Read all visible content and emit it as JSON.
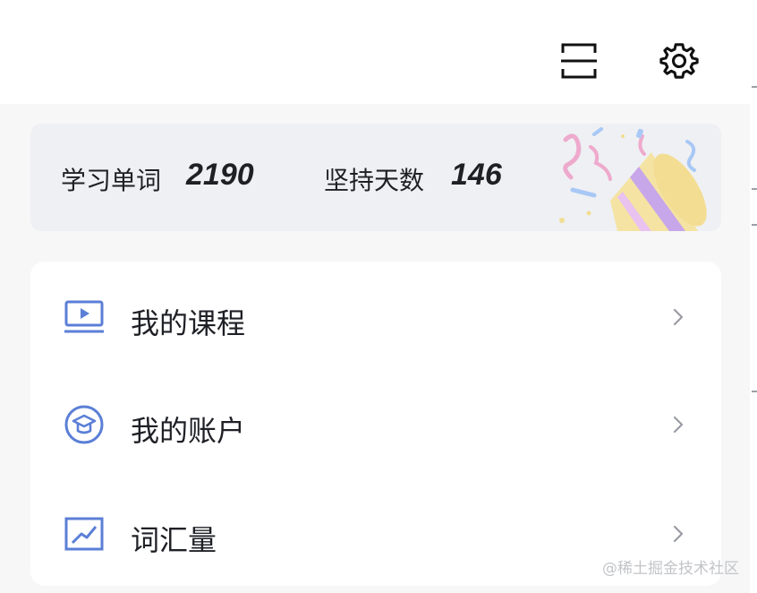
{
  "header": {
    "icons": [
      "scan-icon",
      "settings-gear-icon"
    ]
  },
  "stats": {
    "words_label": "学习单词",
    "words_value": "2190",
    "days_label": "坚持天数",
    "days_value": "146"
  },
  "menu": {
    "items": [
      {
        "label": "我的课程",
        "icon": "video-course-icon"
      },
      {
        "label": "我的账户",
        "icon": "graduation-cap-icon"
      },
      {
        "label": "词汇量",
        "icon": "trend-chart-icon"
      }
    ]
  },
  "watermark": "@稀土掘金技术社区",
  "colors": {
    "accent": "#5b7fd6",
    "text": "#1f2026",
    "background": "#f7f7f8",
    "stats_background": "#eff0f3"
  }
}
